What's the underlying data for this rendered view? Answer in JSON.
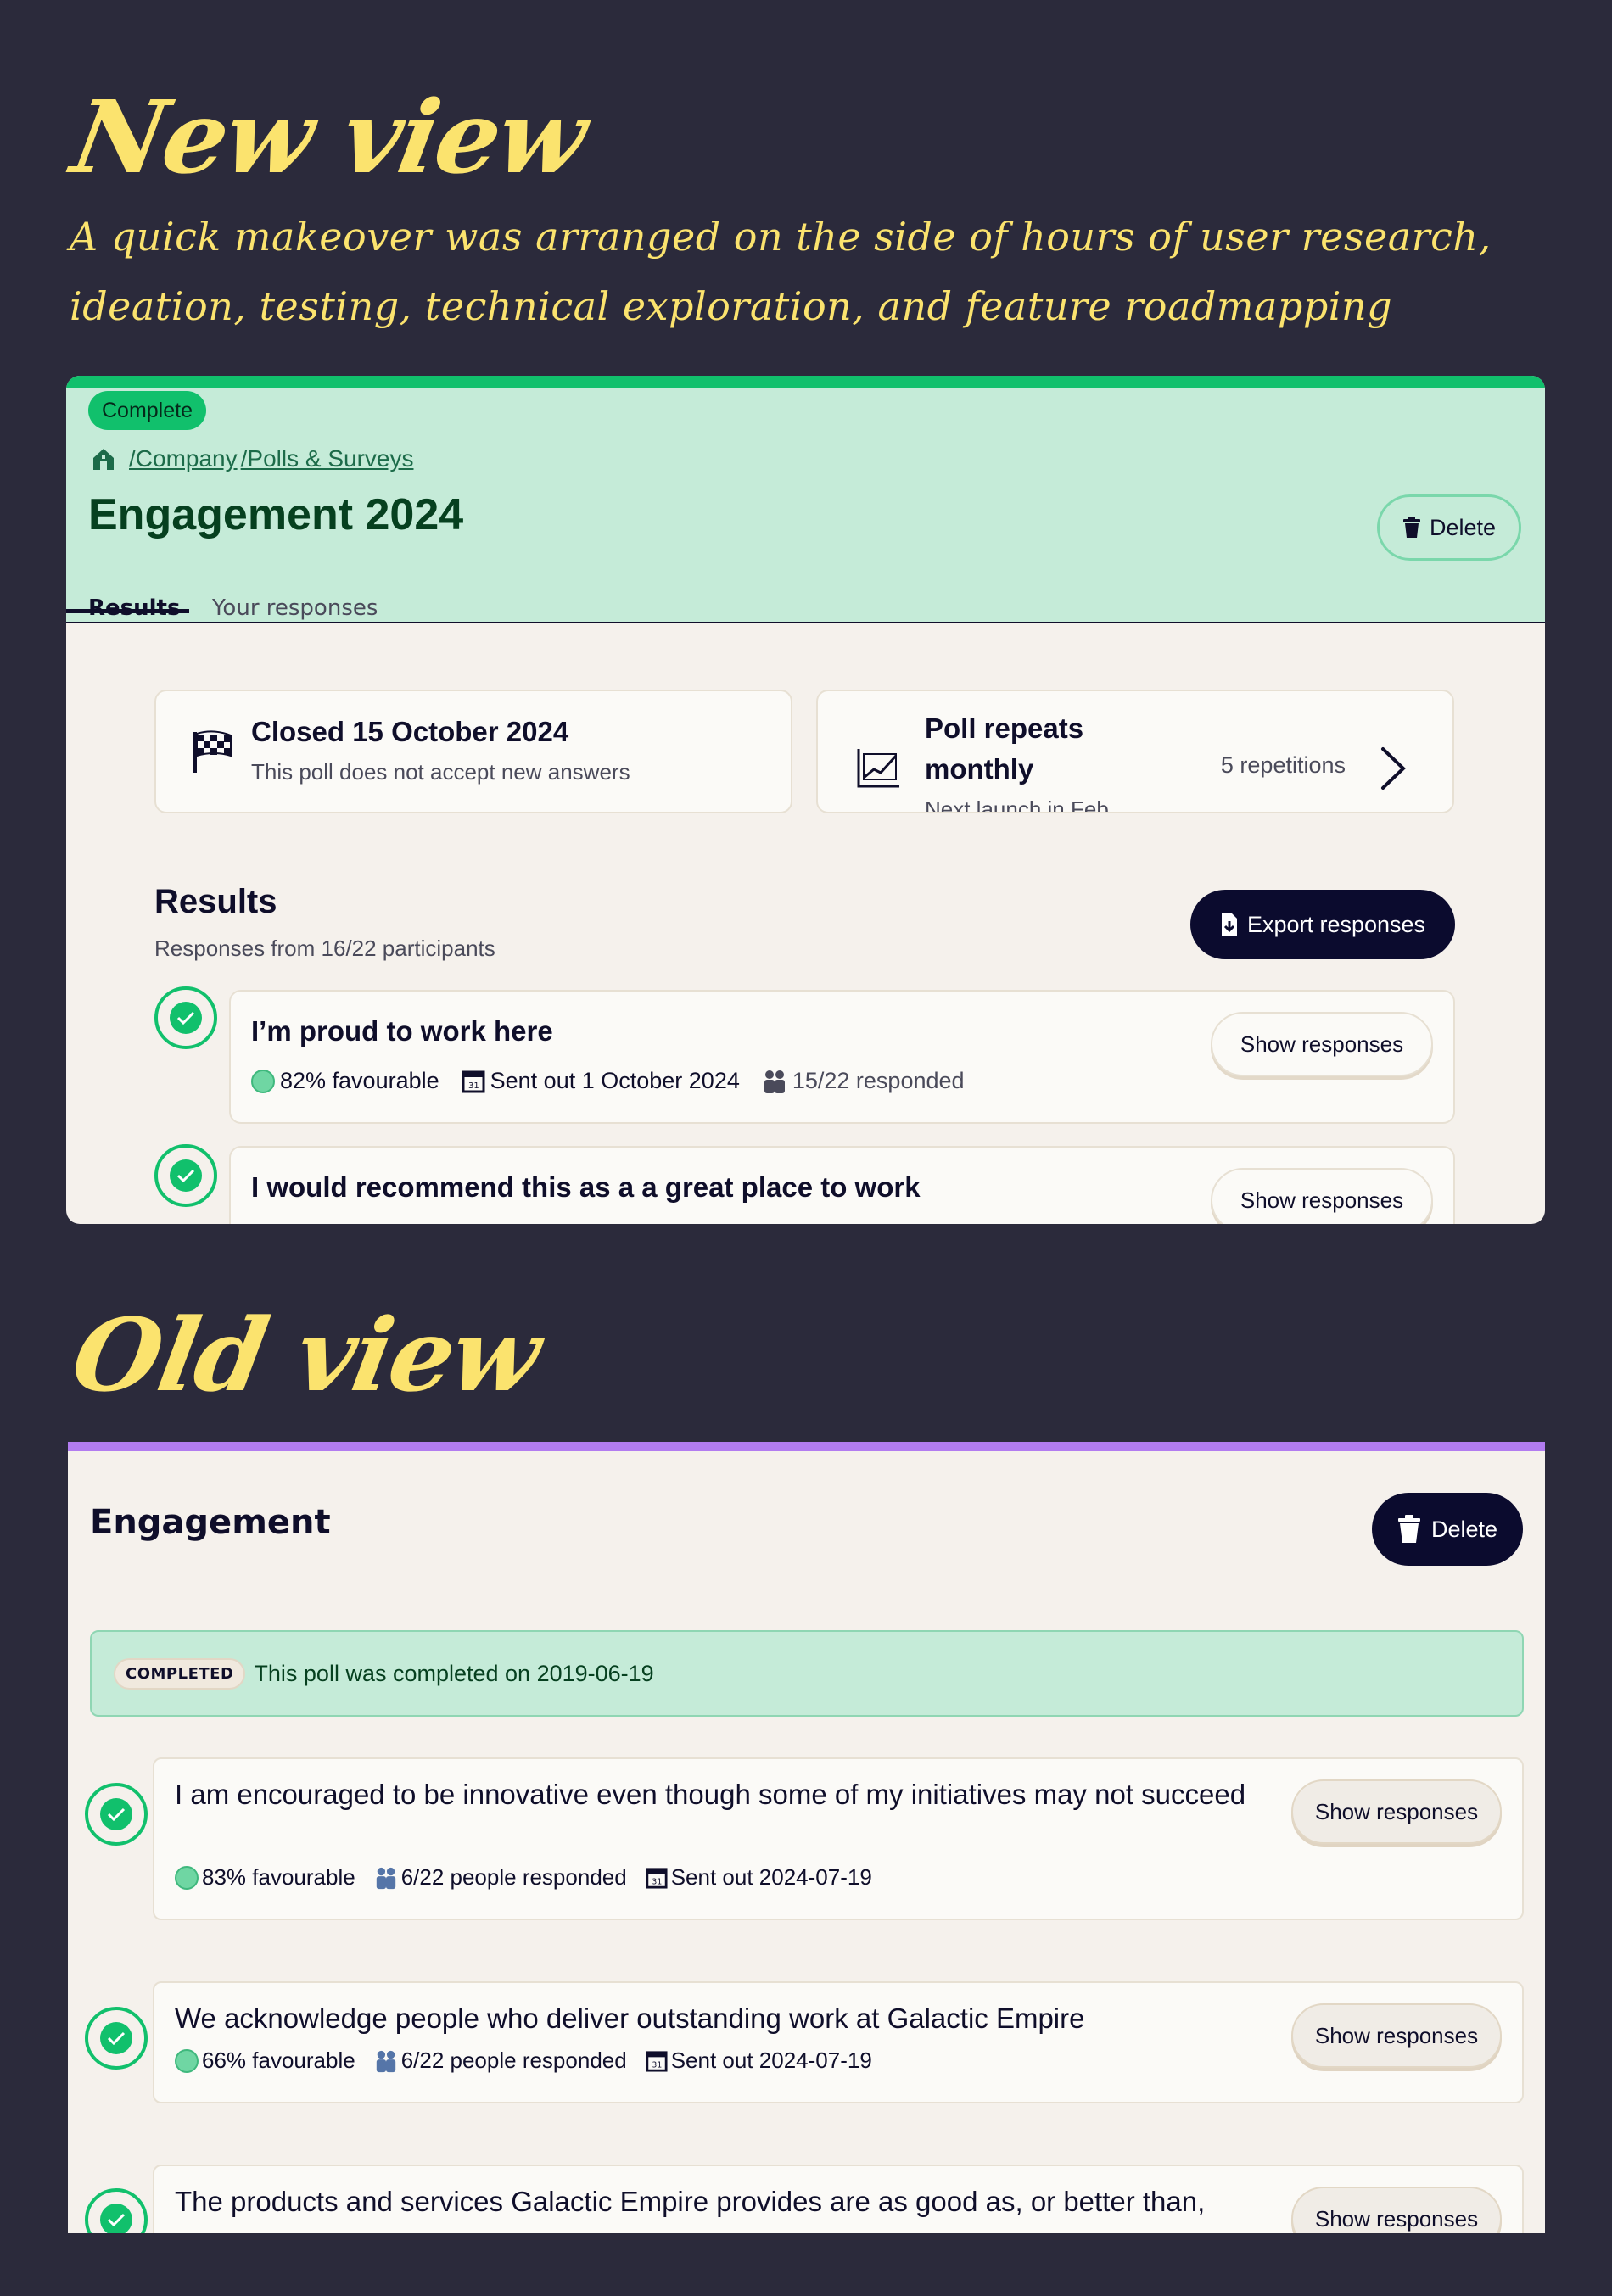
{
  "headings": {
    "new_view": "New view",
    "subtitle": "A quick makeover was arranged on the side of hours of user research, ideation, testing, technical exploration, and feature roadmapping",
    "old_view": "Old view"
  },
  "new_view": {
    "status_badge": "Complete",
    "breadcrumb": [
      "/Company",
      "/Polls & Surveys"
    ],
    "title": "Engagement 2024",
    "delete_label": "Delete",
    "tabs": [
      "Results",
      "Your responses"
    ],
    "closed_card": {
      "title": "Closed 15 October 2024",
      "subtitle": "This poll does not accept new answers"
    },
    "repeat_card": {
      "title_line1": "Poll repeats",
      "title_line2": "monthly",
      "cut_off_text": "Next launch in Feb...",
      "repetitions": "5 repetitions"
    },
    "results": {
      "title": "Results",
      "subtitle": "Responses from 16/22 participants",
      "export_label": "Export responses"
    },
    "questions": [
      {
        "text": "I’m proud to work here",
        "favourable": "82% favourable",
        "sent": "Sent out 1 October 2024",
        "responded": "15/22 responded",
        "button": "Show responses"
      },
      {
        "text": "I would recommend this as a a great place to work",
        "button": "Show responses"
      }
    ]
  },
  "old_view": {
    "title": "Engagement",
    "delete_label": "Delete",
    "banner_pill": "COMPLETED",
    "banner_text": "This poll was completed on 2019-06-19",
    "questions": [
      {
        "text": "I am encouraged to be innovative even though some of my initiatives may not succeed",
        "favourable": "83% favourable",
        "responded": "6/22 people responded",
        "sent": "Sent out 2024-07-19",
        "button": "Show responses"
      },
      {
        "text": "We acknowledge people who deliver outstanding work at Galactic Empire",
        "favourable": "66% favourable",
        "responded": "6/22 people responded",
        "sent": "Sent out 2024-07-19",
        "button": "Show responses"
      },
      {
        "text": "The products and services Galactic Empire provides are as good as, or better than,",
        "button": "Show responses"
      }
    ]
  },
  "colors": {
    "background": "#2b2a3b",
    "handwriting": "#fbe36e",
    "brand_green": "#11c06c",
    "header_mint": "#c5ebd8",
    "old_accent": "#b27cf0",
    "dark_button": "#0b0b2e"
  },
  "icons": {
    "breadcrumb": "home-icon",
    "delete": "trash-icon",
    "closed": "checkered-flag-icon",
    "repeat": "chart-icon",
    "chevron": "chevron-right-icon",
    "export": "download-file-icon",
    "check": "check-circle-icon",
    "favourable": "smiley-icon",
    "calendar": "calendar-icon",
    "people": "people-icon"
  }
}
